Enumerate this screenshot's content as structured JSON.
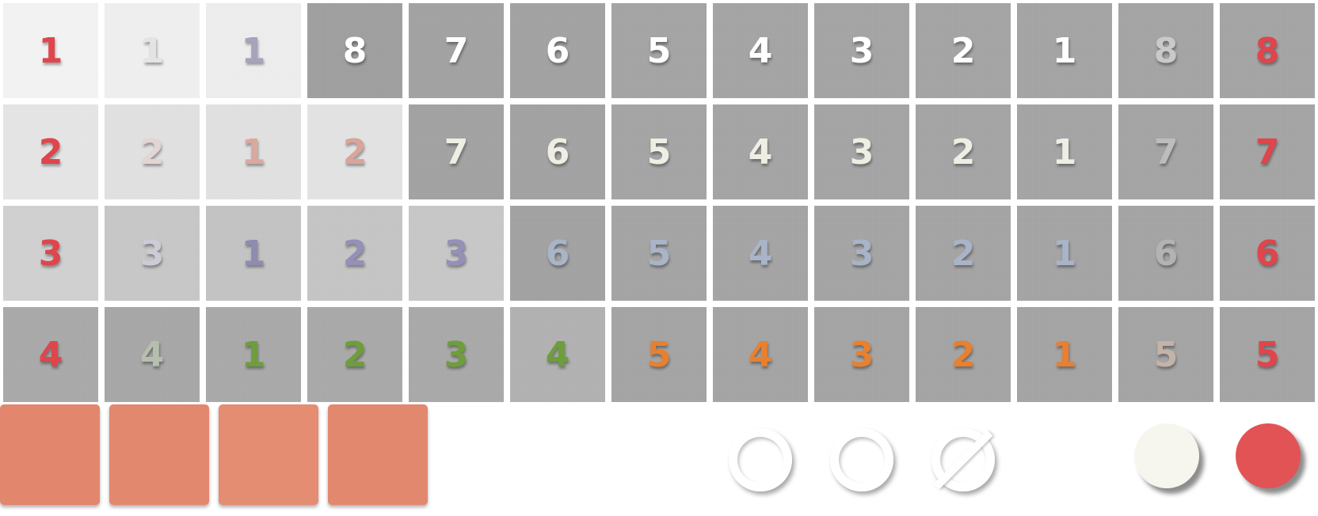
{
  "board": {
    "rows": [
      [
        {
          "value": "1",
          "bg": "#f1f1f1",
          "color": "#e0454c"
        },
        {
          "value": "1",
          "bg": "#eeeeee",
          "color": "#e4e4e4"
        },
        {
          "value": "1",
          "bg": "#ececec",
          "color": "#a6a3bd"
        },
        {
          "value": "8",
          "bg": "#9e9e9e",
          "color": "#ffffff"
        },
        {
          "value": "7",
          "bg": "#a1a1a1",
          "color": "#ffffff"
        },
        {
          "value": "6",
          "bg": "#a1a1a1",
          "color": "#ffffff"
        },
        {
          "value": "5",
          "bg": "#a3a3a3",
          "color": "#ffffff"
        },
        {
          "value": "4",
          "bg": "#a3a3a3",
          "color": "#ffffff"
        },
        {
          "value": "3",
          "bg": "#a3a3a3",
          "color": "#ffffff"
        },
        {
          "value": "2",
          "bg": "#a3a3a3",
          "color": "#ffffff"
        },
        {
          "value": "1",
          "bg": "#a3a3a3",
          "color": "#ffffff"
        },
        {
          "value": "8",
          "bg": "#a3a3a3",
          "color": "#c9c9c9"
        },
        {
          "value": "8",
          "bg": "#a3a3a3",
          "color": "#e0454c"
        }
      ],
      [
        {
          "value": "2",
          "bg": "#e4e4e4",
          "color": "#e0454c"
        },
        {
          "value": "2",
          "bg": "#e0e0e0",
          "color": "#e2d6d4"
        },
        {
          "value": "1",
          "bg": "#e0e0e0",
          "color": "#d9a99f"
        },
        {
          "value": "2",
          "bg": "#e2e2e2",
          "color": "#d9a49a"
        },
        {
          "value": "7",
          "bg": "#a1a1a1",
          "color": "#efeee4"
        },
        {
          "value": "6",
          "bg": "#a1a1a1",
          "color": "#efeee4"
        },
        {
          "value": "5",
          "bg": "#a3a3a3",
          "color": "#efeee4"
        },
        {
          "value": "4",
          "bg": "#a3a3a3",
          "color": "#efeee4"
        },
        {
          "value": "3",
          "bg": "#a3a3a3",
          "color": "#efeee4"
        },
        {
          "value": "2",
          "bg": "#a3a3a3",
          "color": "#efeee4"
        },
        {
          "value": "1",
          "bg": "#a3a3a3",
          "color": "#efeee4"
        },
        {
          "value": "7",
          "bg": "#a3a3a3",
          "color": "#bdbdbd"
        },
        {
          "value": "7",
          "bg": "#a3a3a3",
          "color": "#e0454c"
        }
      ],
      [
        {
          "value": "3",
          "bg": "#cfcfcf",
          "color": "#e0454c"
        },
        {
          "value": "3",
          "bg": "#c6c6c6",
          "color": "#cdcbd6"
        },
        {
          "value": "1",
          "bg": "#c2c2c2",
          "color": "#8f8cb2"
        },
        {
          "value": "2",
          "bg": "#c4c4c4",
          "color": "#9490b8"
        },
        {
          "value": "3",
          "bg": "#c6c6c6",
          "color": "#9490b8"
        },
        {
          "value": "6",
          "bg": "#a1a1a1",
          "color": "#a9b4c8"
        },
        {
          "value": "5",
          "bg": "#a3a3a3",
          "color": "#a9b4c8"
        },
        {
          "value": "4",
          "bg": "#a3a3a3",
          "color": "#a9b4c8"
        },
        {
          "value": "3",
          "bg": "#a3a3a3",
          "color": "#a9b4c8"
        },
        {
          "value": "2",
          "bg": "#a3a3a3",
          "color": "#a9b4c8"
        },
        {
          "value": "1",
          "bg": "#a3a3a3",
          "color": "#a9b4c8"
        },
        {
          "value": "6",
          "bg": "#a3a3a3",
          "color": "#b3b3b3"
        },
        {
          "value": "6",
          "bg": "#a3a3a3",
          "color": "#e0454c"
        }
      ],
      [
        {
          "value": "4",
          "bg": "#a8a8a8",
          "color": "#e0454c"
        },
        {
          "value": "4",
          "bg": "#a6a6a6",
          "color": "#b6bfae"
        },
        {
          "value": "1",
          "bg": "#a8a8a8",
          "color": "#6e9e3c"
        },
        {
          "value": "2",
          "bg": "#a8a8a8",
          "color": "#6e9e3c"
        },
        {
          "value": "3",
          "bg": "#a8a8a8",
          "color": "#6e9e3c"
        },
        {
          "value": "4",
          "bg": "#b0b0b0",
          "color": "#6e9e3c"
        },
        {
          "value": "5",
          "bg": "#a3a3a3",
          "color": "#e8802f"
        },
        {
          "value": "4",
          "bg": "#a3a3a3",
          "color": "#e8802f"
        },
        {
          "value": "3",
          "bg": "#a3a3a3",
          "color": "#e8802f"
        },
        {
          "value": "2",
          "bg": "#a3a3a3",
          "color": "#e8802f"
        },
        {
          "value": "1",
          "bg": "#a3a3a3",
          "color": "#e8802f"
        },
        {
          "value": "5",
          "bg": "#a3a3a3",
          "color": "#c3b3a8"
        },
        {
          "value": "5",
          "bg": "#a3a3a3",
          "color": "#e0454c"
        }
      ]
    ]
  },
  "palette": {
    "tiles": [
      {
        "name": "color-tile-1",
        "color": "#e2866d"
      },
      {
        "name": "color-tile-2",
        "color": "#e2886f"
      },
      {
        "name": "color-tile-3",
        "color": "#e48d72"
      },
      {
        "name": "color-tile-4",
        "color": "#e2886f"
      }
    ]
  },
  "controls": {
    "rings": [
      {
        "icon": "ring-icon"
      },
      {
        "icon": "ring-icon"
      },
      {
        "icon": "ring-slash-icon"
      }
    ],
    "dots": [
      {
        "icon": "cream-circle-icon",
        "color": "#f6f6ef"
      },
      {
        "icon": "red-circle-icon",
        "color": "#e25355"
      }
    ]
  }
}
